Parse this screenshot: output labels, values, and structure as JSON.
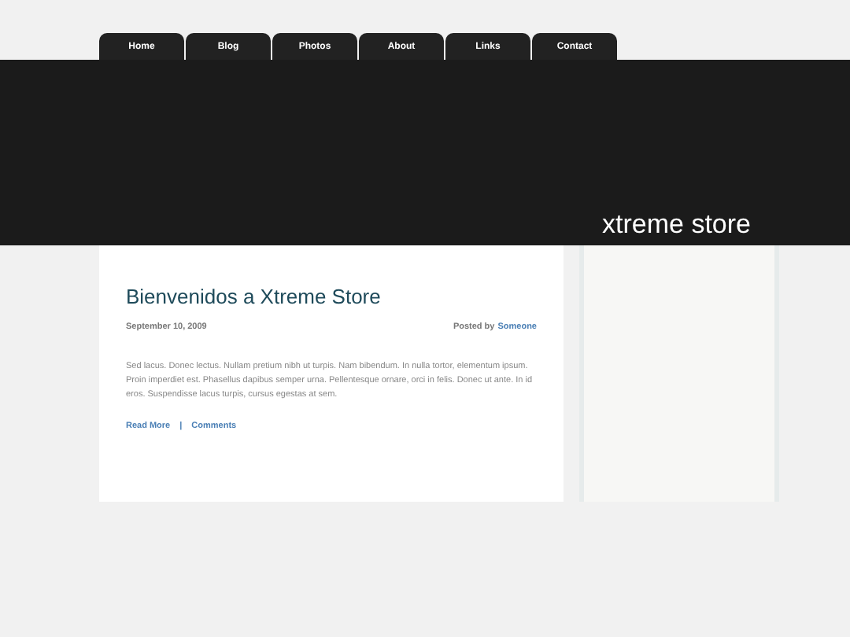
{
  "nav": [
    {
      "label": "Home"
    },
    {
      "label": "Blog"
    },
    {
      "label": "Photos"
    },
    {
      "label": "About"
    },
    {
      "label": "Links"
    },
    {
      "label": "Contact"
    }
  ],
  "header": {
    "site_title": "xtreme store"
  },
  "post": {
    "title": "Bienvenidos a Xtreme Store",
    "date": "September 10, 2009",
    "posted_by": "Posted by",
    "author": "Someone",
    "body": "Sed lacus. Donec lectus. Nullam pretium nibh ut turpis. Nam bibendum. In nulla tortor, elementum ipsum. Proin imperdiet est. Phasellus dapibus semper urna. Pellentesque ornare, orci in felis. Donec ut ante. In id eros. Suspendisse lacus turpis, cursus egestas at sem.",
    "links": [
      "Read More",
      "Comments"
    ],
    "separator": "|"
  }
}
